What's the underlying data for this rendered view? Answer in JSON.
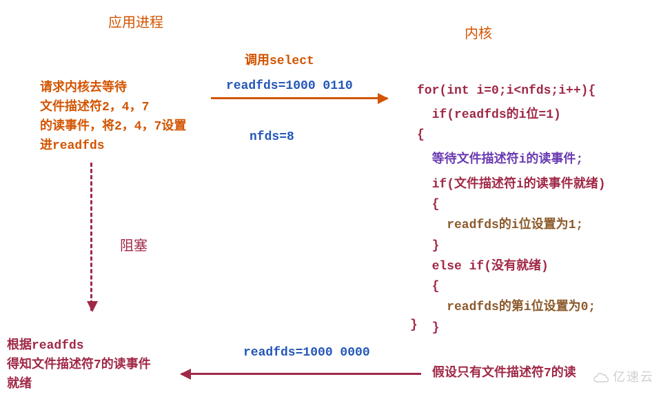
{
  "header": {
    "left_title": "应用进程",
    "right_title": "内核"
  },
  "left_request": {
    "l1": "请求内核去等待",
    "l2": "文件描述符2，4，7",
    "l3": "的读事件，将2，4，7设置",
    "l4": "进readfds"
  },
  "arrow_up": {
    "label_top": "调用select",
    "readfds": "readfds=1000 0110",
    "nfds": "nfds=8"
  },
  "blocking_label": "阻塞",
  "result_box": {
    "l1": "根据readfds",
    "l2": "得知文件描述符7的读事件",
    "l3": "就绪"
  },
  "arrow_down": {
    "readfds": "readfds=1000 0000",
    "assume": "假设只有文件描述符7的读"
  },
  "code": {
    "c1": "for(int i=0;i<nfds;i++){",
    "c2": "  if(readfds的i位=1)",
    "c3": "{",
    "c4": "  等待文件描述符i的读事件;",
    "c5": "  if(文件描述符i的读事件就绪)",
    "c6": "  {",
    "c7": "    readfds的i位设置为1;",
    "c8": "  }",
    "c9": "  else if(没有就绪)",
    "c10": "  {",
    "c11": "    readfds的第i位设置为0;",
    "c12": "  }",
    "c13": "}"
  },
  "watermark": "亿速云"
}
